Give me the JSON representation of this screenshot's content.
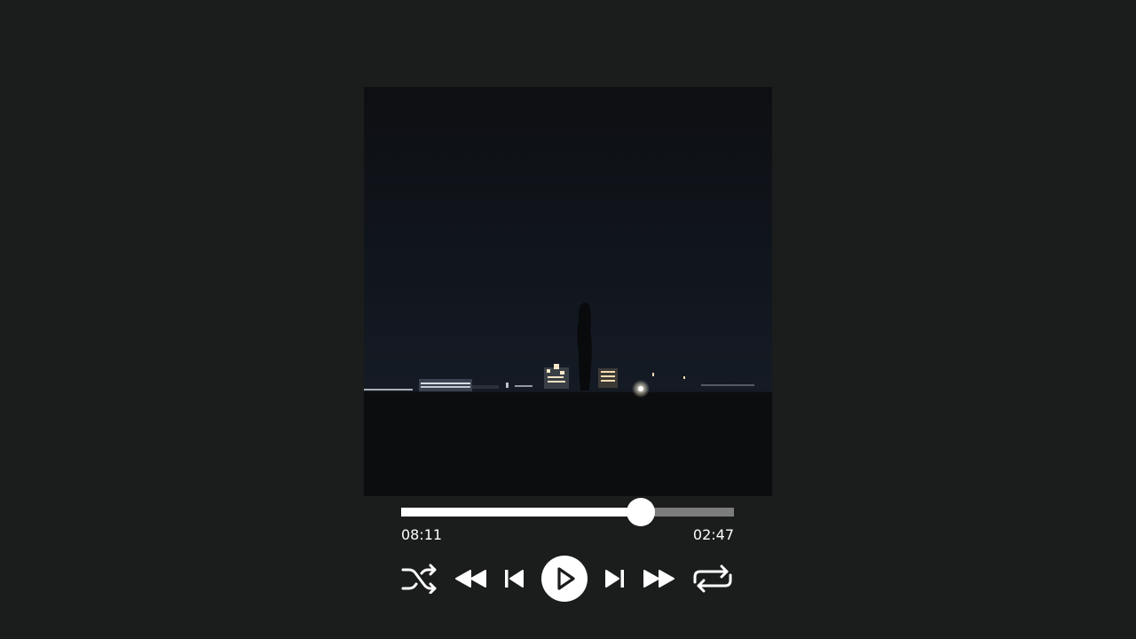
{
  "player": {
    "artwork": {
      "description_icon": "album-art-night-skyline"
    },
    "progress": {
      "fraction": 0.72,
      "elapsed": "08:11",
      "remaining": "02:47"
    },
    "controls": {
      "shuffle_icon": "shuffle-icon",
      "rewind_icon": "rewind-icon",
      "previous_icon": "skip-previous-icon",
      "play_icon": "play-icon",
      "next_icon": "skip-next-icon",
      "fast_forward_icon": "fast-forward-icon",
      "repeat_icon": "repeat-icon"
    },
    "colors": {
      "background": "#1b1c1c",
      "accent": "#ffffff",
      "track": "#7c7c7c"
    }
  }
}
